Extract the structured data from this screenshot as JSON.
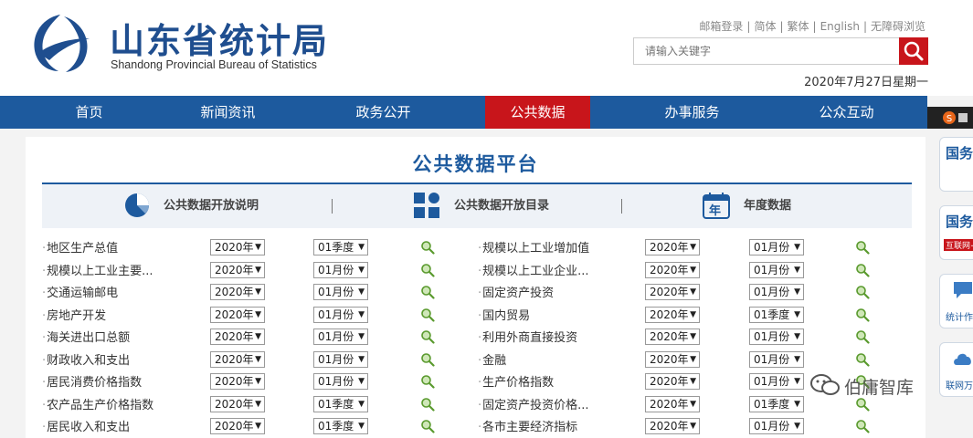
{
  "header": {
    "title": "山东省统计局",
    "subtitle": "Shandong Provincial Bureau of Statistics",
    "links": [
      "邮箱登录",
      "简体",
      "繁体",
      "English",
      "无障碍浏览"
    ],
    "search_placeholder": "请输入关键字",
    "date": "2020年7月27日星期一"
  },
  "nav": {
    "items": [
      "首页",
      "新闻资讯",
      "政务公开",
      "公共数据",
      "办事服务",
      "公众互动"
    ],
    "active": "公共数据"
  },
  "main": {
    "title": "公共数据平台",
    "bar": [
      "公共数据开放说明",
      "公共数据开放目录",
      "年度数据"
    ],
    "bar_year_icon": "年",
    "rows": [
      {
        "left": {
          "name": "地区生产总值",
          "year": "2020年",
          "period": "01季度"
        },
        "right": {
          "name": "规模以上工业增加值",
          "year": "2020年",
          "period": "01月份"
        }
      },
      {
        "left": {
          "name": "规模以上工业主要...",
          "year": "2020年",
          "period": "01月份"
        },
        "right": {
          "name": "规模以上工业企业...",
          "year": "2020年",
          "period": "01月份"
        }
      },
      {
        "left": {
          "name": "交通运输邮电",
          "year": "2020年",
          "period": "01月份"
        },
        "right": {
          "name": "固定资产投资",
          "year": "2020年",
          "period": "01月份"
        }
      },
      {
        "left": {
          "name": "房地产开发",
          "year": "2020年",
          "period": "01月份"
        },
        "right": {
          "name": "国内贸易",
          "year": "2020年",
          "period": "01季度"
        }
      },
      {
        "left": {
          "name": "海关进出口总额",
          "year": "2020年",
          "period": "01月份"
        },
        "right": {
          "name": "利用外商直接投资",
          "year": "2020年",
          "period": "01月份"
        }
      },
      {
        "left": {
          "name": "财政收入和支出",
          "year": "2020年",
          "period": "01月份"
        },
        "right": {
          "name": "金融",
          "year": "2020年",
          "period": "01月份"
        }
      },
      {
        "left": {
          "name": "居民消费价格指数",
          "year": "2020年",
          "period": "01月份"
        },
        "right": {
          "name": "生产价格指数",
          "year": "2020年",
          "period": "01月份"
        }
      },
      {
        "left": {
          "name": "农产品生产价格指数",
          "year": "2020年",
          "period": "01季度"
        },
        "right": {
          "name": "固定资产投资价格...",
          "year": "2020年",
          "period": "01季度"
        }
      },
      {
        "left": {
          "name": "居民收入和支出",
          "year": "2020年",
          "period": "01季度"
        },
        "right": {
          "name": "各市主要经济指标",
          "year": "2020年",
          "period": "01月份"
        }
      }
    ]
  },
  "side": {
    "tabs": [
      {
        "title": "国务",
        "sub": ""
      },
      {
        "title": "国务",
        "sub": "互联网+"
      },
      {
        "title": "",
        "sub": "统计作"
      },
      {
        "title": "",
        "sub": "联网万"
      }
    ]
  },
  "watermark": "伯庸智库",
  "colors": {
    "brand_blue": "#1d5a9e",
    "accent_red": "#c8151b"
  },
  "icons": [
    "logo-icon",
    "search-icon",
    "pie-chart-icon",
    "grid-icon",
    "calendar-icon",
    "magnifier-icon",
    "wechat-icon",
    "chat-icon",
    "cloud-icon"
  ]
}
